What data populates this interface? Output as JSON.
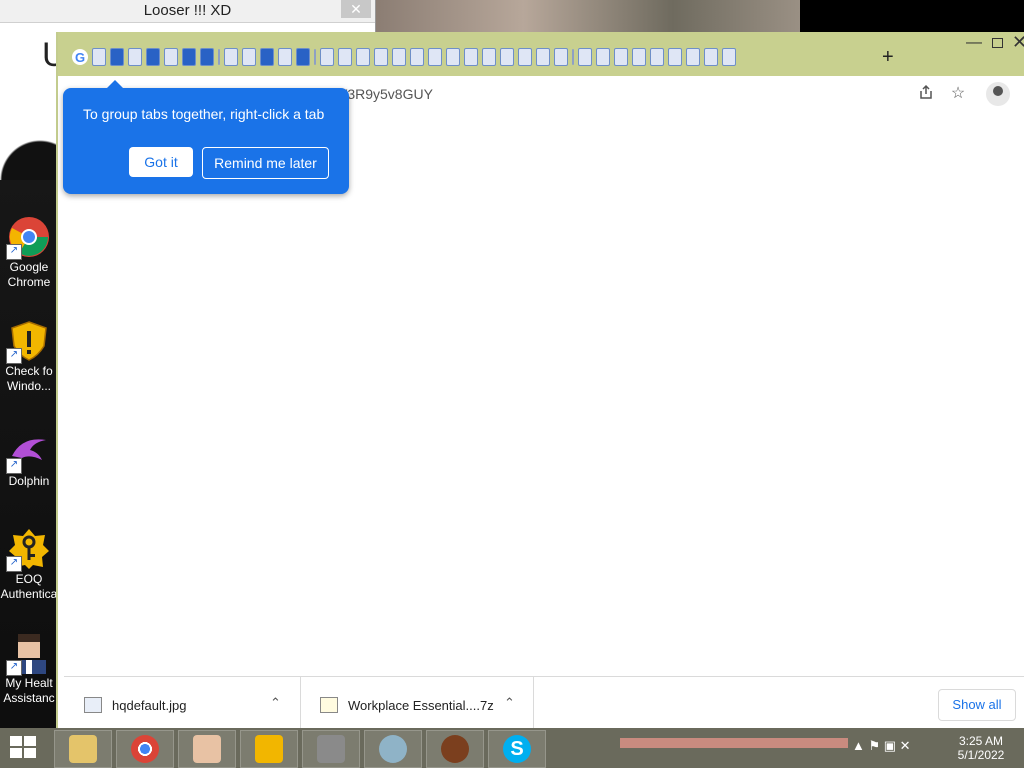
{
  "back_window": {
    "title": "Looser !!! XD",
    "close": "✕",
    "letter": "U"
  },
  "desktop_icons": [
    {
      "label_line1": "Google",
      "label_line2": "Chrome"
    },
    {
      "label_line1": "Check fo",
      "label_line2": "Windo..."
    },
    {
      "label_line1": "Dolphin",
      "label_line2": ""
    },
    {
      "label_line1": "EOQ",
      "label_line2": "Authentica"
    },
    {
      "label_line1": "My Healt",
      "label_line2": "Assistanc"
    }
  ],
  "browser": {
    "new_tab": "+",
    "minimize": "—",
    "close": "✕",
    "address_fragment": "V3R9y5v8GUY",
    "tooltip": {
      "text": "To group tabs together, right-click a tab",
      "got_it": "Got it",
      "remind": "Remind me later"
    }
  },
  "downloads": [
    {
      "name": "hqdefault.jpg",
      "chevron": "⌃"
    },
    {
      "name": "Workplace Essential....7z",
      "chevron": "⌃"
    }
  ],
  "show_all": "Show all",
  "tray": {
    "time": "3:25 AM",
    "date": "5/1/2022",
    "icons": "▲ ⚑ ▣ ✕"
  },
  "colors": {
    "accent": "#1a73e8",
    "tabstrip": "#c8d08f",
    "taskbar": "#6a6a5c"
  }
}
